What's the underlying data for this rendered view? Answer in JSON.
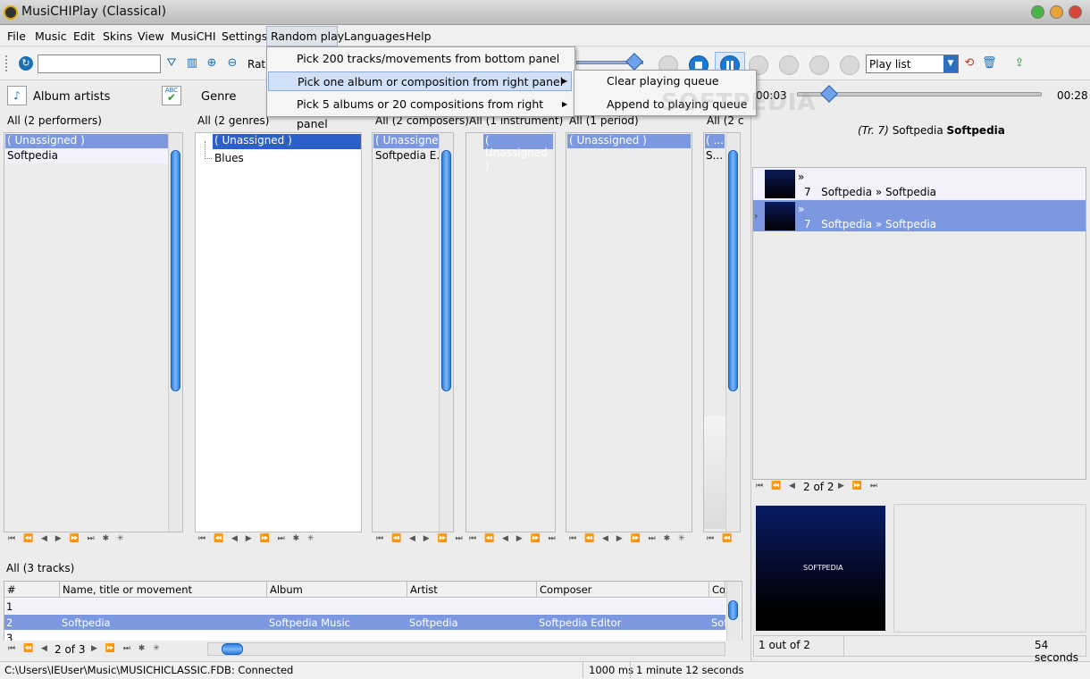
{
  "window": {
    "title": "MusiCHIPlay (Classical)"
  },
  "menu": {
    "items": [
      "File",
      "Music",
      "Edit",
      "Skins",
      "View",
      "MusiCHI",
      "Settings",
      "Random play",
      "Languages",
      "Help"
    ]
  },
  "toolbar": {
    "rating_label": "Rati",
    "playlist_select": "Play list"
  },
  "random_menu": {
    "items": [
      "Pick 200 tracks/movements from bottom panel",
      "Pick one album or composition from right panel",
      "Pick 5 albums or 20 compositions from right panel"
    ]
  },
  "submenu": {
    "items": [
      "Clear playing queue",
      "Append to playing queue"
    ]
  },
  "panels": {
    "album_artists": {
      "header": "Album artists",
      "summary": "All (2 performers)",
      "items": [
        "( Unassigned )",
        "Softpedia"
      ]
    },
    "genre": {
      "header": "Genre",
      "summary": "All (2 genres)",
      "items": [
        "( Unassigned )",
        "Blues"
      ]
    },
    "composers": {
      "summary": "All (2 composers)",
      "items": [
        "( Unassigned )",
        "Softpedia E..."
      ]
    },
    "instrument": {
      "summary": "All (1 instrument)",
      "items": [
        "( Unassigned )"
      ]
    },
    "period": {
      "summary": "All (1 period)",
      "items": [
        "( Unassigned )"
      ]
    },
    "extra": {
      "summary": "All (2 c",
      "items": [
        "( ...",
        "S..."
      ]
    }
  },
  "tracks": {
    "summary": "All (3 tracks)",
    "columns": [
      "#",
      "Name, title or movement",
      "Album",
      "Artist",
      "Composer",
      "Cor"
    ],
    "rows": [
      [
        "1",
        "",
        "",
        "",
        "",
        ""
      ],
      [
        "2",
        "Softpedia",
        "Softpedia Music",
        "Softpedia",
        "Softpedia Editor",
        "Sof"
      ],
      [
        "3",
        "",
        "",
        "",
        "",
        ""
      ]
    ],
    "page": "2 of 3"
  },
  "player": {
    "elapsed": "00:03",
    "total": "00:28",
    "position_fraction": 0.13,
    "now_playing_track": "(Tr. 7)",
    "now_playing_artist": "Softpedia",
    "now_playing_title": "Softpedia"
  },
  "queue": {
    "items": [
      {
        "marker": "»",
        "text": "7   Softpedia » Softpedia"
      },
      {
        "marker": "»",
        "text": "7   Softpedia » Softpedia"
      }
    ],
    "page": "2 of 2"
  },
  "cover": {
    "label": "SOFTPEDIA"
  },
  "queue_status": {
    "count": "1 out of 2",
    "duration": "54 seconds"
  },
  "status": {
    "path": "C:\\Users\\IEUser\\Music\\MUSICHICLASSIC.FDB: Connected",
    "interval": "1000 ms",
    "total_time": "1 minute 12 seconds"
  },
  "watermark": "SOFTPEDIA",
  "colors": {
    "selection": "#7b98e0",
    "accent": "#1e7ad0"
  }
}
